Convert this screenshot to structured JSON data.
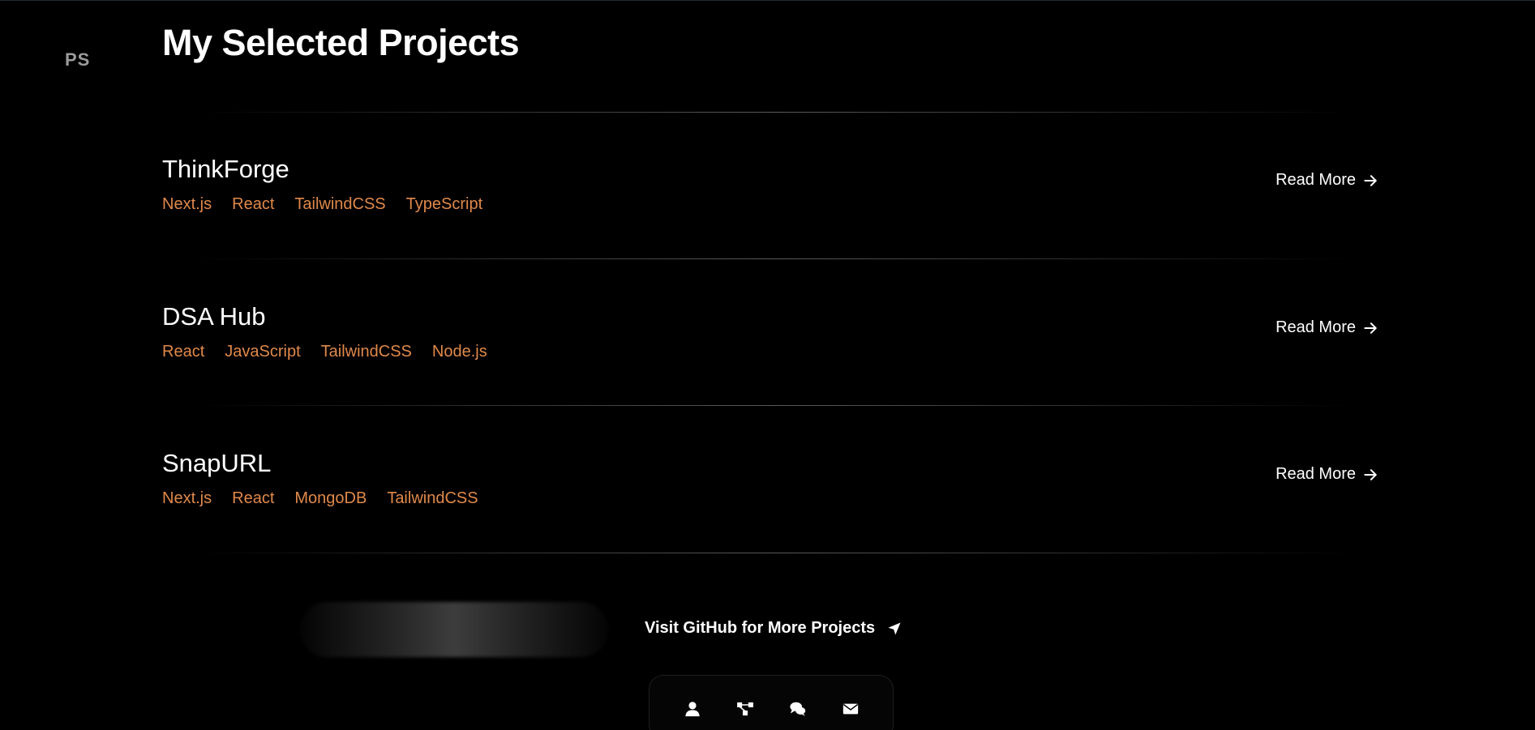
{
  "logo": "PS",
  "heading": "My Selected Projects",
  "projects": [
    {
      "title": "ThinkForge",
      "tags": [
        "Next.js",
        "React",
        "TailwindCSS",
        "TypeScript"
      ],
      "cta": "Read More"
    },
    {
      "title": "DSA Hub",
      "tags": [
        "React",
        "JavaScript",
        "TailwindCSS",
        "Node.js"
      ],
      "cta": "Read More"
    },
    {
      "title": "SnapURL",
      "tags": [
        "Next.js",
        "React",
        "MongoDB",
        "TailwindCSS"
      ],
      "cta": "Read More"
    }
  ],
  "github_link": "Visit GitHub for More Projects",
  "dock": [
    {
      "icon": "user-icon"
    },
    {
      "icon": "network-icon"
    },
    {
      "icon": "chat-icon"
    },
    {
      "icon": "envelope-icon"
    }
  ],
  "colors": {
    "background": "#000000",
    "tag": "#e0894a",
    "text": "#ffffff",
    "logo": "#9b9b9b"
  }
}
